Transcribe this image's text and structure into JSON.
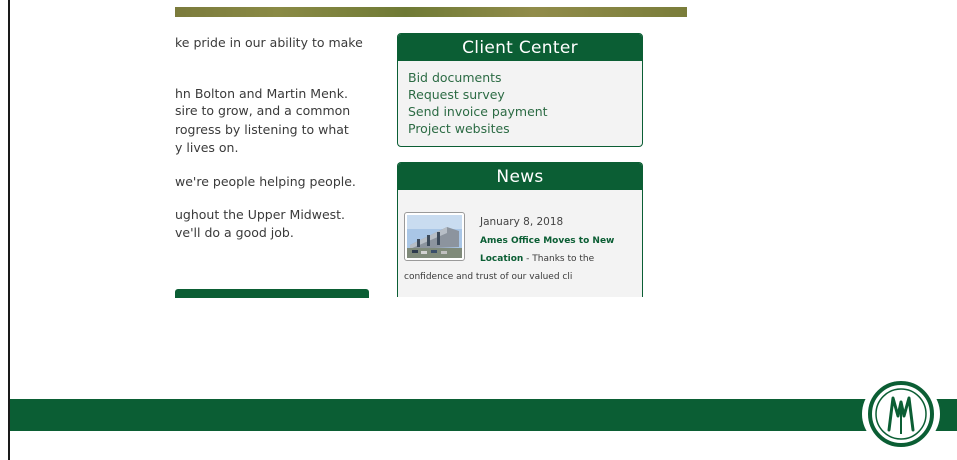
{
  "about": {
    "lines": [
      "ke pride in our ability to make",
      "hn Bolton and Martin Menk.",
      "sire to grow, and a common",
      "rogress by listening to what",
      "y lives on.",
      "we're people helping people.",
      "ughout the Upper Midwest.",
      "ve'll do a good job."
    ]
  },
  "client_center": {
    "title": "Client Center",
    "links": [
      "Bid documents",
      "Request survey",
      "Send invoice payment",
      "Project websites"
    ]
  },
  "news": {
    "title": "News",
    "date": "January 8, 2018",
    "headline_part1": "Ames Office Moves to New",
    "headline_part2": "Location",
    "snippet_part1": " - Thanks to the",
    "snippet_part2": "confidence and trust of our valued cli"
  },
  "colors": {
    "brand_green": "#0b5e34",
    "link_green": "#2c6b44"
  },
  "icons": {
    "footer_logo": "bolton-menk-logo",
    "news_image": "office-building-photo"
  }
}
